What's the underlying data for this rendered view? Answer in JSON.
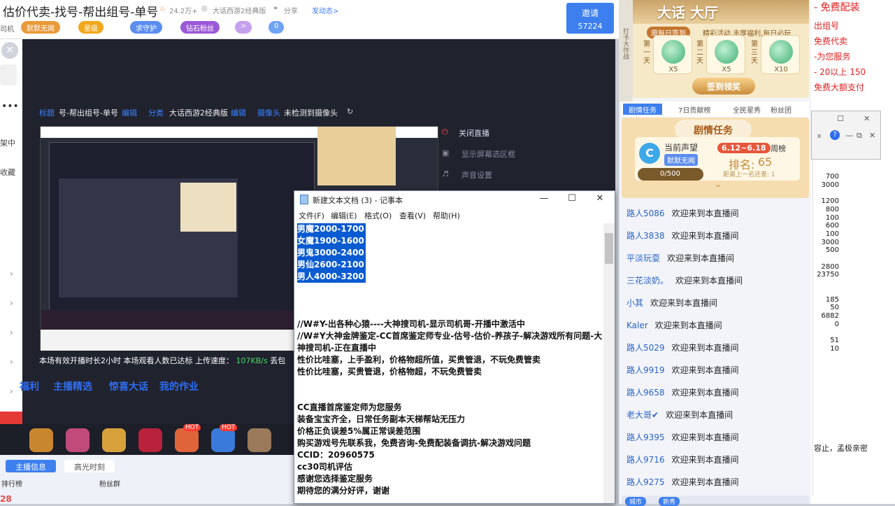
{
  "header": {
    "title": "估价代卖-找号-帮出组号-单号",
    "popularity": "24.2万+",
    "game": "大话西游2经典版",
    "share": "分享",
    "post_dynamic": "发动态>",
    "left_cut": "司机",
    "badges": [
      "默默无闻",
      "星级",
      "求守护",
      "钻石粉丝",
      ">",
      "0"
    ],
    "invite": {
      "label": "邀请",
      "count": "57224"
    }
  },
  "left_strip": {
    "items": [
      "架中",
      "收藏"
    ],
    "bottom_items": [
      "排行榜"
    ],
    "bottom_number": "28"
  },
  "stage": {
    "title_label": "标题",
    "title_value": "号-帮出组号-单号",
    "edit": "编辑",
    "category_label": "分类",
    "category_value": "大话西游2经典版",
    "camera_label": "摄像头",
    "camera_value": "未检测到摄像头",
    "menu": [
      "关闭直播",
      "显示屏幕选区框",
      "声音设置"
    ],
    "status": "本场有效开播时长2小时  本场观看人数已达标  上传速度：",
    "speed": "107KB/s",
    "status_tail": "丢包",
    "tiles": [
      "福利",
      "主播精选",
      "惊喜大话",
      "我的作业"
    ]
  },
  "gift_labels": [
    "HOT",
    "HOT"
  ],
  "bottom_tabs": {
    "tabs": [
      "主播信息",
      "高光时刻"
    ],
    "fans": "粉丝群"
  },
  "notepad": {
    "title": "新建文本文档 (3) - 记事本",
    "menu": [
      "文件(F)",
      "编辑(E)",
      "格式(O)",
      "查看(V)",
      "帮助(H)"
    ],
    "highlighted": [
      "男魔2000-1700",
      "女魔1900-1600",
      "男鬼3000-2400",
      "男仙2600-2100",
      "男人4000-3200"
    ],
    "lines": [
      "//W#Y-出各种心猿----大神搜司机-显示司机哥-开播中激活中",
      "//W#Y大神金牌鉴定-CC首席鉴定师专业-估号-估价-养孩子-解决游戏所有问题-大神搜司机-正在直播中",
      "性价比哇塞，上手盈利，价格物超所值，买贵管退，不玩免费管卖",
      "性价比哇塞，买贵管退，价格物超，不玩免费管卖",
      "",
      "",
      "CC直播首席鉴定师为您服务",
      "装备宝宝齐全，日常任务副本天梯帮站无压力",
      "价格正负误差5%属正常误差范围",
      "购买游戏号先联系我，免费咨询-免费配装备调抗-解决游戏问题",
      "CCID：20960575",
      "cc30司机评估",
      "感谢您选择鉴定服务",
      "期待您的满分好评，谢谢"
    ]
  },
  "right_panel": {
    "ad_strip": "打卡大作战",
    "hall_title": "大话  大厅",
    "signin": "原每日签到",
    "signin_desc": "精彩活动,丰厚福利,每日必玩",
    "days": [
      {
        "day": "第一天",
        "reward": "X5"
      },
      {
        "day": "第二天",
        "reward": "X5"
      },
      {
        "day": "第三天",
        "reward": "X10"
      }
    ],
    "sign_button": "签到领奖",
    "tabs": [
      "剧情任务",
      "7日贡献榜",
      "全民星秀",
      "粉丝团"
    ],
    "story_title": "剧情任务",
    "current_rep": "当前声望",
    "rep_level": "默默无闻",
    "date_range": "6.12~6.18",
    "weekly": "周榜",
    "rank_label": "排名:",
    "rank_value": "65",
    "rank_gap": "距离上一名还差: 1",
    "progress_text": "0/500",
    "progress": 0,
    "chat": [
      {
        "user": "路人5086",
        "msg": "欢迎来到本直播间"
      },
      {
        "user": "路人3838",
        "msg": "欢迎来到本直播间"
      },
      {
        "user": "平淡玩耍",
        "msg": "欢迎来到本直播间"
      },
      {
        "user": "三花淡奶。",
        "msg": "欢迎来到本直播间"
      },
      {
        "user": "小其",
        "msg": "欢迎来到本直播间"
      },
      {
        "user": "Kaler",
        "msg": "欢迎来到本直播间"
      },
      {
        "user": "路人5029",
        "msg": "欢迎来到本直播间"
      },
      {
        "user": "路人9919",
        "msg": "欢迎来到本直播间"
      },
      {
        "user": "路人9658",
        "msg": "欢迎来到本直播间"
      },
      {
        "user": "老大哥✔",
        "msg": "欢迎来到本直播间"
      },
      {
        "user": "路人9395",
        "msg": "欢迎来到本直播间"
      },
      {
        "user": "路人9716",
        "msg": "欢迎来到本直播间"
      },
      {
        "user": "路人9275",
        "msg": "欢迎来到本直播间"
      }
    ],
    "bottom_buttons": [
      "城市",
      "新秀"
    ]
  },
  "far_right": {
    "red_lines": [
      "- 免费配装",
      "出组号",
      "免费代卖",
      "-为您服务",
      "- 20以上 150",
      "免费大额支付"
    ],
    "excel_values": [
      "700",
      "3000",
      "",
      "1200",
      "800",
      "100",
      "600",
      "100",
      "3000",
      "500",
      "",
      "2800",
      "23750",
      "",
      "",
      "185",
      "50",
      "6882",
      "0",
      "",
      "51",
      "10"
    ],
    "tail_text": "容止，孟极亲密"
  },
  "colors": {
    "accent": "#3d7fef",
    "stage": "#20222e",
    "chat_user": "#2b63c5",
    "highlight": "#0a5bd1",
    "red_text": "#e02020"
  }
}
